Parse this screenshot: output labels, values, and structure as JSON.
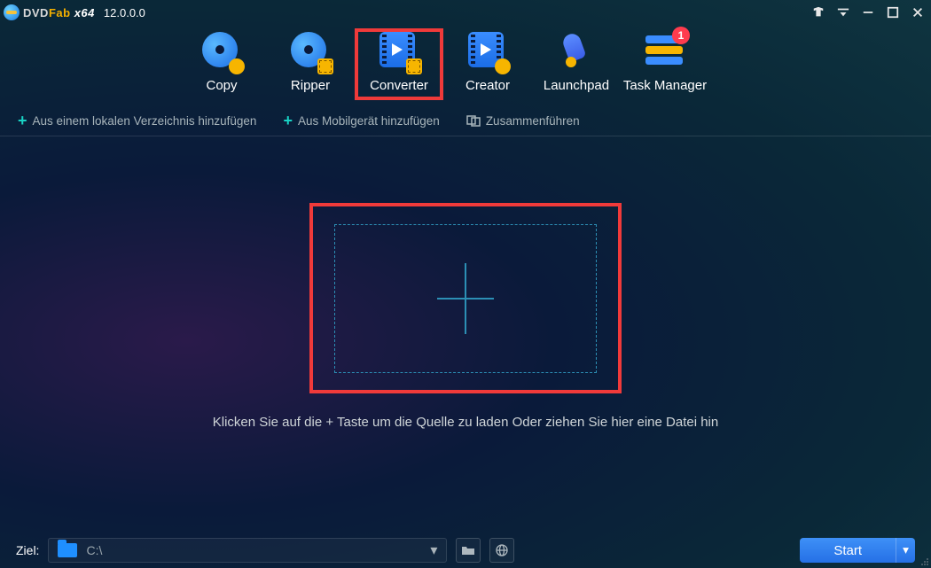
{
  "app": {
    "brand_dvd": "DVD",
    "brand_fab": "Fab",
    "brand_arch": "x64",
    "version": "12.0.0.0"
  },
  "tabs": {
    "copy": "Copy",
    "ripper": "Ripper",
    "converter": "Converter",
    "creator": "Creator",
    "launchpad": "Launchpad",
    "task_manager": "Task Manager",
    "task_badge": "1"
  },
  "toolbar": {
    "add_local": "Aus einem lokalen Verzeichnis hinzufügen",
    "add_mobile": "Aus Mobilgerät hinzufügen",
    "merge": "Zusammenführen"
  },
  "drop_hint": "Klicken Sie auf die + Taste um die Quelle zu laden Oder ziehen Sie hier eine Datei hin",
  "footer": {
    "dest_label": "Ziel:",
    "dest_path": "C:\\",
    "start": "Start"
  }
}
